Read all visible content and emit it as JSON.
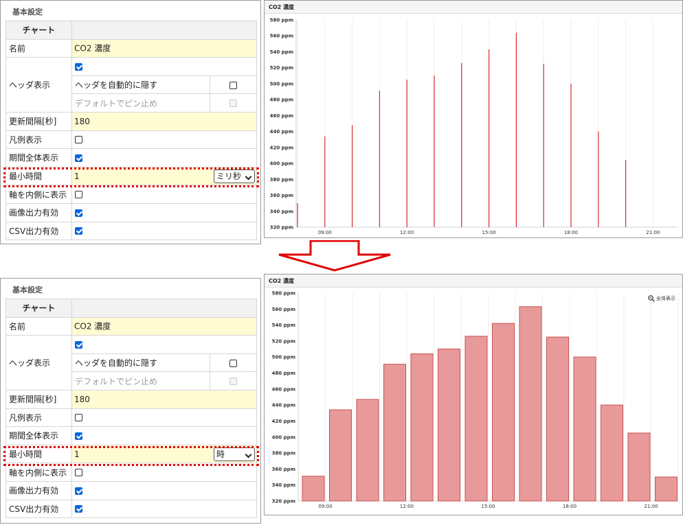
{
  "colors": {
    "bar_fill": "#e89a9a",
    "bar_stroke": "#cc4f4f",
    "line": "#d62828",
    "highlight": "#e00000",
    "input_bg": "#fffbd3",
    "checkbox_on": "#0a66d8"
  },
  "form": {
    "title": "基本設定",
    "chart_header": "チャート",
    "name_label": "名前",
    "name_value": "CO2 濃度",
    "header_label": "ヘッダ表示",
    "header_checked": true,
    "auto_hide_label": "ヘッダを自動的に隠す",
    "auto_hide_checked": false,
    "default_pin_label": "デフォルトでピン止め",
    "default_pin_checked": false,
    "interval_label": "更新間隔[秒]",
    "interval_value": "180",
    "legend_label": "凡例表示",
    "legend_checked": false,
    "full_period_label": "期間全体表示",
    "full_period_checked": true,
    "min_time_label": "最小時間",
    "min_time_value": "1",
    "axis_inside_label": "軸を内側に表示",
    "axis_inside_checked": false,
    "image_output_label": "画像出力有効",
    "image_output_checked": true,
    "csv_output_label": "CSV出力有効",
    "csv_output_checked": true
  },
  "panels": [
    {
      "min_time_unit": "ミリ秒",
      "chart_type": "line"
    },
    {
      "min_time_unit": "時",
      "chart_type": "bar"
    }
  ],
  "zoom_label": "全体表示",
  "zoom_icon": "zoom-out-icon",
  "arrow_icon": "down-arrow-icon",
  "chart_data": [
    {
      "type": "line",
      "title": "CO2 濃度",
      "x": [
        "08:00",
        "09:00",
        "10:00",
        "11:00",
        "12:00",
        "13:00",
        "14:00",
        "15:00",
        "16:00",
        "17:00",
        "18:00",
        "19:00",
        "20:00"
      ],
      "values": [
        350,
        434,
        448,
        491,
        505,
        510,
        526,
        543,
        564,
        525,
        500,
        440,
        404
      ],
      "x_ticks": [
        "09:00",
        "12:00",
        "15:00",
        "18:00",
        "21:00"
      ],
      "y_ticks": [
        "320 ppm",
        "340 ppm",
        "360 ppm",
        "380 ppm",
        "400 ppm",
        "420 ppm",
        "440 ppm",
        "460 ppm",
        "480 ppm",
        "500 ppm",
        "520 ppm",
        "540 ppm",
        "560 ppm",
        "580 ppm"
      ],
      "ylim": [
        320,
        580
      ],
      "grid": true
    },
    {
      "type": "bar",
      "title": "CO2 濃度",
      "x": [
        "08:00",
        "09:00",
        "10:00",
        "11:00",
        "12:00",
        "13:00",
        "14:00",
        "15:00",
        "16:00",
        "17:00",
        "18:00",
        "19:00",
        "20:00",
        "21:00"
      ],
      "values": [
        351,
        434,
        447,
        491,
        504,
        510,
        526,
        542,
        563,
        525,
        500,
        440,
        405,
        350
      ],
      "x_ticks": [
        "09:00",
        "12:00",
        "15:00",
        "18:00",
        "21:00"
      ],
      "y_ticks": [
        "320 ppm",
        "340 ppm",
        "360 ppm",
        "380 ppm",
        "400 ppm",
        "420 ppm",
        "440 ppm",
        "460 ppm",
        "480 ppm",
        "500 ppm",
        "520 ppm",
        "540 ppm",
        "560 ppm",
        "580 ppm"
      ],
      "ylim": [
        320,
        580
      ],
      "grid": true
    }
  ]
}
